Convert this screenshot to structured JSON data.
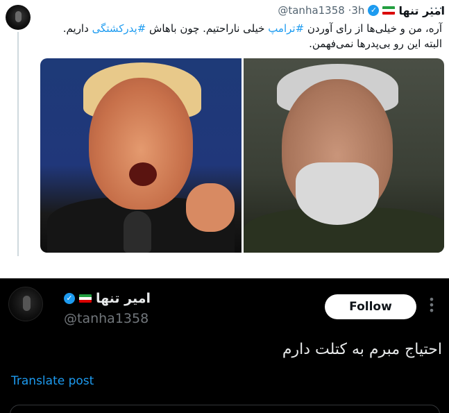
{
  "top_tweet": {
    "author_name": "امیر تنها",
    "handle": "@tanha1358",
    "time": "3h",
    "more_label": "···",
    "verified_icon": "check-badge-icon",
    "flag_icon": "iran-flag-icon",
    "body": {
      "line1_a": "آره، من و خیلی‌ها از رای آوردن ",
      "hashtag1": "#ترامپ",
      "line1_b": " خیلی ناراحتیم. چون باهاش ",
      "hashtag2": "#پدرکشتگی",
      "line1_c": " داریم.",
      "line2": "البته این رو بی‌پدرها نمی‌فهمن."
    },
    "media_count": 2
  },
  "bottom_tweet": {
    "author_name": "امیر تنها",
    "handle": "@tanha1358",
    "follow_label": "Follow",
    "text": "احتیاج مبرم به کتلت دارم",
    "translate_label": "Translate post",
    "verified_icon": "check-badge-icon",
    "flag_icon": "iran-flag-icon"
  },
  "colors": {
    "accent_blue": "#1d9bf0",
    "dark_bg": "#000000",
    "light_text": "#e7e9ea",
    "muted": "#71767b"
  }
}
